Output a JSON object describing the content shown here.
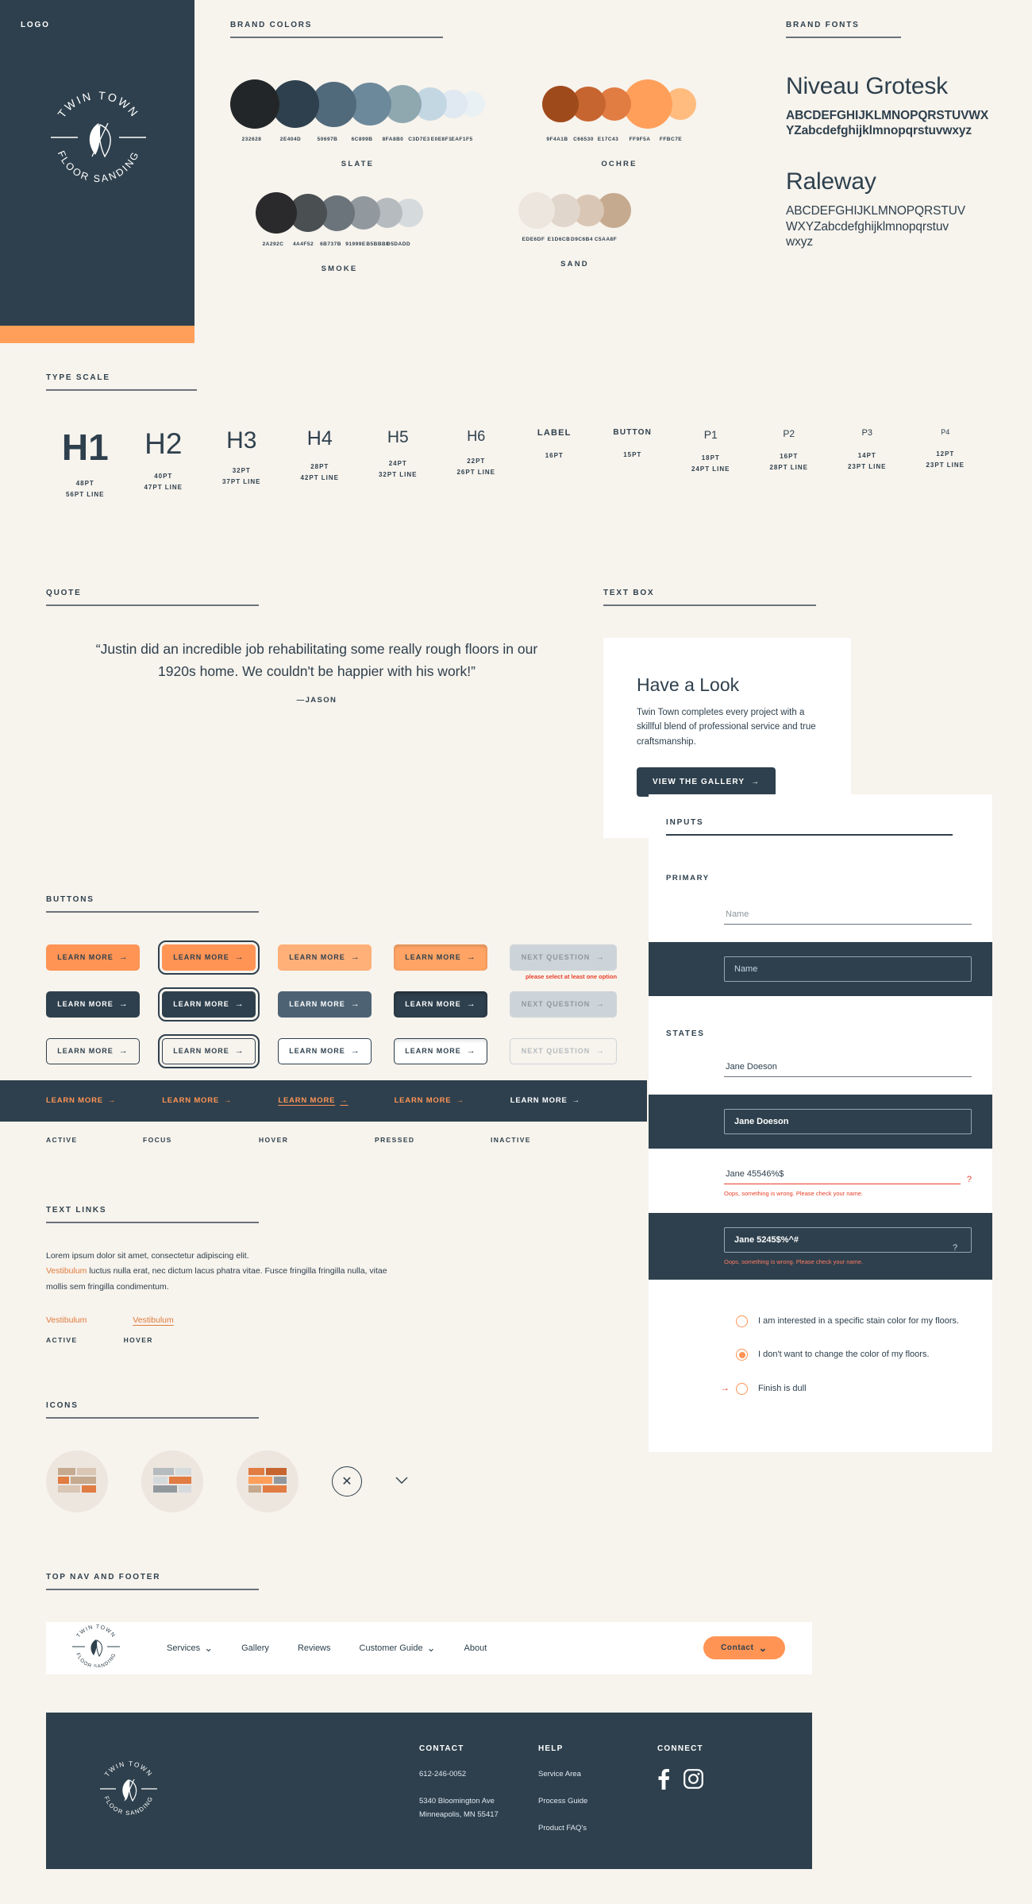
{
  "brand": {
    "name": "Twin Town Floor Sanding",
    "logo_top": "TWIN TOWN",
    "logo_bottom": "FLOOR SANDING"
  },
  "sections": {
    "logo": "LOGO",
    "brand_colors": "BRAND COLORS",
    "brand_fonts": "BRAND FONTS",
    "type_scale": "TYPE SCALE",
    "quote": "QUOTE",
    "text_box": "TEXT BOX",
    "buttons": "BUTTONS",
    "text_links": "TEXT LINKS",
    "icons": "ICONS",
    "inputs": "INPUTS",
    "states": "STATES",
    "top_nav_and_footer": "TOP NAV AND FOOTER"
  },
  "palettes": [
    {
      "name": "SLATE",
      "hexes": [
        "232628",
        "2E404D",
        "50697B",
        "6C899B",
        "8FA8B0",
        "C3D7E3",
        "E0E8F1",
        "EAF1F5"
      ],
      "sizes": [
        62,
        60,
        57,
        54,
        48,
        42,
        36,
        32
      ]
    },
    {
      "name": "OCHRE",
      "hexes": [
        "9F4A1B",
        "C66530",
        "E17C43",
        "FF9F5A",
        "FFBC7E"
      ],
      "sizes": [
        46,
        44,
        42,
        62,
        40
      ]
    },
    {
      "name": "SMOKE",
      "hexes": [
        "2A292C",
        "4A4F52",
        "6B737B",
        "91999E",
        "B5BBBF",
        "D5DADD"
      ],
      "sizes": [
        52,
        48,
        45,
        42,
        38,
        36
      ]
    },
    {
      "name": "SAND",
      "hexes": [
        "EDE6DF",
        "E1D6CB",
        "D9C6B4",
        "C5AA8F"
      ],
      "sizes": [
        46,
        42,
        40,
        44
      ]
    }
  ],
  "fonts": [
    {
      "name": "Niveau Grotesk",
      "specimen_upper": "ABCDEFGHIJKLMNOPQRSTUVWX",
      "specimen_lower": "YZabcdefghijklmnopqrstuvwxyz",
      "bold": true
    },
    {
      "name": "Raleway",
      "specimen_upper": "ABCDEFGHIJKLMNOPQRSTUV",
      "specimen_lower": "WXYZabcdefghijklmnopqrstuv",
      "specimen_tail": "wxyz",
      "bold": false
    }
  ],
  "type_scale": [
    {
      "label": "H1",
      "size": 46,
      "weight": 700,
      "pt": "48PT",
      "line": "56PT LINE"
    },
    {
      "label": "H2",
      "size": 37,
      "weight": 400,
      "pt": "40PT",
      "line": "47PT LINE"
    },
    {
      "label": "H3",
      "size": 30,
      "weight": 400,
      "pt": "32PT",
      "line": "37PT LINE"
    },
    {
      "label": "H4",
      "size": 25,
      "weight": 400,
      "pt": "28PT",
      "line": "42PT LINE"
    },
    {
      "label": "H5",
      "size": 21,
      "weight": 400,
      "pt": "24PT",
      "line": "32PT LINE"
    },
    {
      "label": "H6",
      "size": 18,
      "weight": 400,
      "pt": "22PT",
      "line": "26PT LINE"
    },
    {
      "label": "LABEL",
      "size": 11,
      "weight": 700,
      "pt": "16PT",
      "line": ""
    },
    {
      "label": "BUTTON",
      "size": 10,
      "weight": 700,
      "pt": "15PT",
      "line": ""
    },
    {
      "label": "P1",
      "size": 14,
      "weight": 400,
      "pt": "18PT",
      "line": "24PT LINE"
    },
    {
      "label": "P2",
      "size": 12,
      "weight": 400,
      "pt": "16PT",
      "line": "28PT LINE"
    },
    {
      "label": "P3",
      "size": 11,
      "weight": 400,
      "pt": "14PT",
      "line": "23PT LINE"
    },
    {
      "label": "P4",
      "size": 9,
      "weight": 400,
      "pt": "12PT",
      "line": "23PT LINE"
    }
  ],
  "quote": {
    "text": "“Justin did an incredible job rehabilitating some really rough floors in our 1920s home. We couldn't be happier with his work!”",
    "attribution": "—JASON"
  },
  "text_box": {
    "heading": "Have a Look",
    "body": "Twin Town completes every project with a skillful blend of professional service and true craftsmanship.",
    "button": "VIEW THE GALLERY",
    "arrow": "→"
  },
  "buttons": {
    "learn_more": "LEARN MORE",
    "next_question": "NEXT QUESTION",
    "arrow": "→",
    "error": "please select at least one option",
    "states": [
      "ACTIVE",
      "FOCUS",
      "HOVER",
      "PRESSED",
      "INACTIVE"
    ]
  },
  "text_links": {
    "paragraph_1": "Lorem ipsum dolor sit amet, consectetur adipiscing elit.",
    "link_inline": "Vestibulum",
    "paragraph_2": " luctus nulla erat, nec dictum lacus phatra vitae. Fusce fringilla fringilla nulla, vitae mollis sem fringilla condimentum.",
    "demo_active": "Vestibulum",
    "demo_hover": "Vestibulum",
    "state_active": "ACTIVE",
    "state_hover": "HOVER"
  },
  "icons": {
    "names": [
      "floor-boards-icon",
      "floor-planks-icon",
      "floor-pattern-icon",
      "close-icon",
      "chevron-down-icon"
    ],
    "close_glyph": "✕",
    "chevron_glyph": "⌄"
  },
  "inputs": {
    "primary_label": "PRIMARY",
    "states_label": "STATES",
    "placeholder": "Name",
    "value_valid": "Jane Doeson",
    "value_error_light": "Jane 45546%$",
    "value_error_dark": "Jane 5245$%^#",
    "error_message": "Oops, something is wrong. Please check your name.",
    "error_mark": "?"
  },
  "radios": [
    {
      "label": "I am interested in a specific stain color for my floors.",
      "selected": false,
      "focused": false
    },
    {
      "label": "I don't want to change the color of my floors.",
      "selected": true,
      "focused": false
    },
    {
      "label": "Finish is dull",
      "selected": false,
      "focused": true
    }
  ],
  "nav": {
    "items": [
      {
        "label": "Services",
        "caret": "⌄"
      },
      {
        "label": "Gallery",
        "caret": ""
      },
      {
        "label": "Reviews",
        "caret": ""
      },
      {
        "label": "Customer Guide",
        "caret": "⌄"
      },
      {
        "label": "About",
        "caret": ""
      }
    ],
    "cta": "Contact",
    "cta_caret": "⌄"
  },
  "footer": {
    "contact": {
      "heading": "CONTACT",
      "phone": "612-246-0052",
      "address_1": "5340 Bloomington Ave",
      "address_2": "Minneapolis, MN 55417"
    },
    "help": {
      "heading": "HELP",
      "items": [
        "Service Area",
        "Process Guide",
        "Product FAQ's"
      ]
    },
    "connect": {
      "heading": "CONNECT",
      "social": [
        "facebook-icon",
        "instagram-icon"
      ]
    }
  },
  "colors": {
    "background": "#F7F3ED",
    "navy": "#2E404D",
    "orange": "#FF9455",
    "error": "#E8402A",
    "white": "#FFFFFF"
  }
}
